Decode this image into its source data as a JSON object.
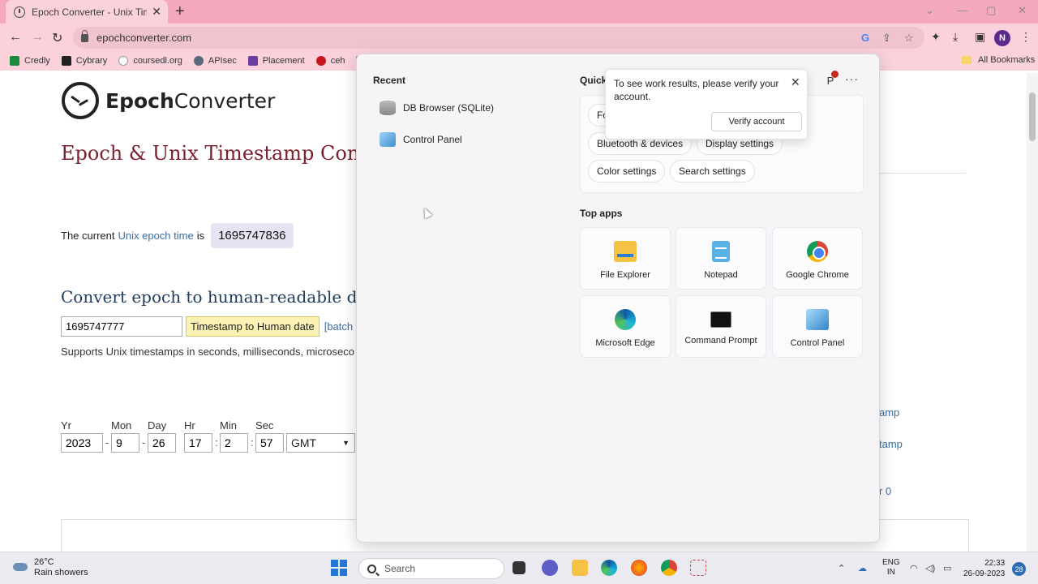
{
  "browser": {
    "tab_title": "Epoch Converter - Unix Timesta",
    "url": "epochconverter.com",
    "bookmarks": [
      "Credly",
      "Cybrary",
      "coursedl.org",
      "APIsec",
      "Placement",
      "ceh"
    ],
    "all_bookmarks": "All Bookmarks",
    "profile_initial": "N"
  },
  "page": {
    "logo_bold": "Epoch",
    "logo_rest": "Converter",
    "heading": "Epoch & Unix Timestamp Con",
    "current_prefix": "The current",
    "current_link": "Unix epoch time",
    "current_is": "is",
    "current_epoch": "1695747836",
    "convert_heading": "Convert epoch to human-readable dat",
    "timestamp_value": "1695747777",
    "convert_button": "Timestamp to Human date",
    "batch_link": "[batch",
    "supports_text": "Supports Unix timestamps in seconds, milliseconds, microseco",
    "date_labels": {
      "yr": "Yr",
      "mon": "Mon",
      "day": "Day",
      "hr": "Hr",
      "min": "Min",
      "sec": "Sec"
    },
    "date_values": {
      "yr": "2023",
      "mon": "9",
      "day": "26",
      "hr": "17",
      "min": "2",
      "sec": "57"
    },
    "timezone": "GMT",
    "right_links": [
      "amp",
      "tamp",
      "r 0"
    ]
  },
  "start_menu": {
    "recent_title": "Recent",
    "recent_items": [
      "DB Browser (SQLite)",
      "Control Panel"
    ],
    "quick_title": "Quick",
    "quick_settings": [
      "Fo",
      "Bluetooth & devices",
      "Display settings",
      "Color settings",
      "Search settings"
    ],
    "top_apps_title": "Top apps",
    "top_apps": [
      "File Explorer",
      "Notepad",
      "Google Chrome",
      "Microsoft Edge",
      "Command Prompt",
      "Control Panel"
    ],
    "profile_initial": "P"
  },
  "notification": {
    "message": "To see work results, please verify your account.",
    "button": "Verify account"
  },
  "taskbar": {
    "temperature": "26°C",
    "weather": "Rain showers",
    "search_placeholder": "Search",
    "lang_top": "ENG",
    "lang_bottom": "IN",
    "time": "22:33",
    "date": "26-09-2023",
    "notification_count": "28"
  }
}
